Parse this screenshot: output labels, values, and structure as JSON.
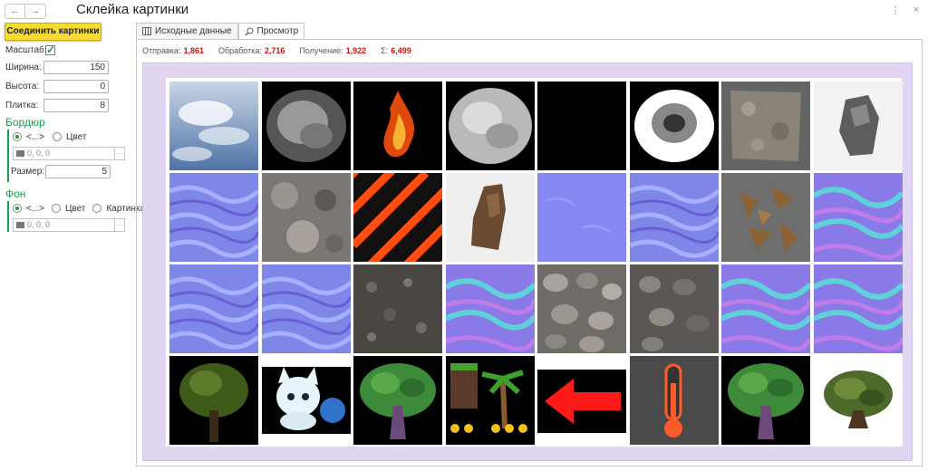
{
  "window": {
    "title": "Склейка картинки",
    "nav_back": "←",
    "nav_fwd": "→",
    "menu_glyph": "⋮",
    "close_glyph": "×"
  },
  "form": {
    "merge_button": "Соединить картинки",
    "scale_label": "Масштаб:",
    "scale_checked": true,
    "width_label": "Ширина:",
    "width_value": "150",
    "height_label": "Высота:",
    "height_value": "0",
    "tile_label": "Плитка:",
    "tile_value": "8",
    "border": {
      "title": "Бордюр",
      "opt_default": "<...>",
      "opt_color": "Цвет",
      "color_value": "0, 0, 0",
      "size_label": "Размер:",
      "size_value": "5"
    },
    "background": {
      "title": "Фон",
      "opt_default": "<...>",
      "opt_color": "Цвет",
      "opt_picture": "Картинка",
      "color_value": "0, 0, 0"
    }
  },
  "tabs": [
    {
      "label": "Исходные данные",
      "icon": "grid-icon"
    },
    {
      "label": "Просмотр",
      "icon": "search-icon"
    }
  ],
  "stats": {
    "send_label": "Отправка:",
    "send_value": "1,861",
    "process_label": "Обработка:",
    "process_value": "2,716",
    "receive_label": "Получение:",
    "receive_value": "1,922",
    "sum_label": "Σ:",
    "sum_value": "6,499"
  },
  "colors": {
    "accent_yellow": "#f4dc33",
    "group_green": "#16a04a",
    "stat_red": "#d21010",
    "canvas_lilac": "#e0d6f2"
  },
  "tiles": [
    "sky-clouds",
    "smoke-gray",
    "fire",
    "noise-gray",
    "black",
    "smoke-white",
    "rock-gray",
    "stone",
    "normal-map",
    "rock-texture",
    "hazard-stripes",
    "rock-brown",
    "normal-map-flat",
    "normal-map",
    "leaves-brown",
    "normal-map-green",
    "normal-map",
    "normal-map",
    "ground-dark",
    "normal-map-green",
    "pebbles",
    "pebbles-dark",
    "normal-map-green",
    "normal-map-green",
    "tree-dark",
    "cat-cartoon",
    "tree-cartoon",
    "palm-sprites",
    "red-arrow",
    "thermometer",
    "tree-cartoon",
    "tree-bush"
  ]
}
